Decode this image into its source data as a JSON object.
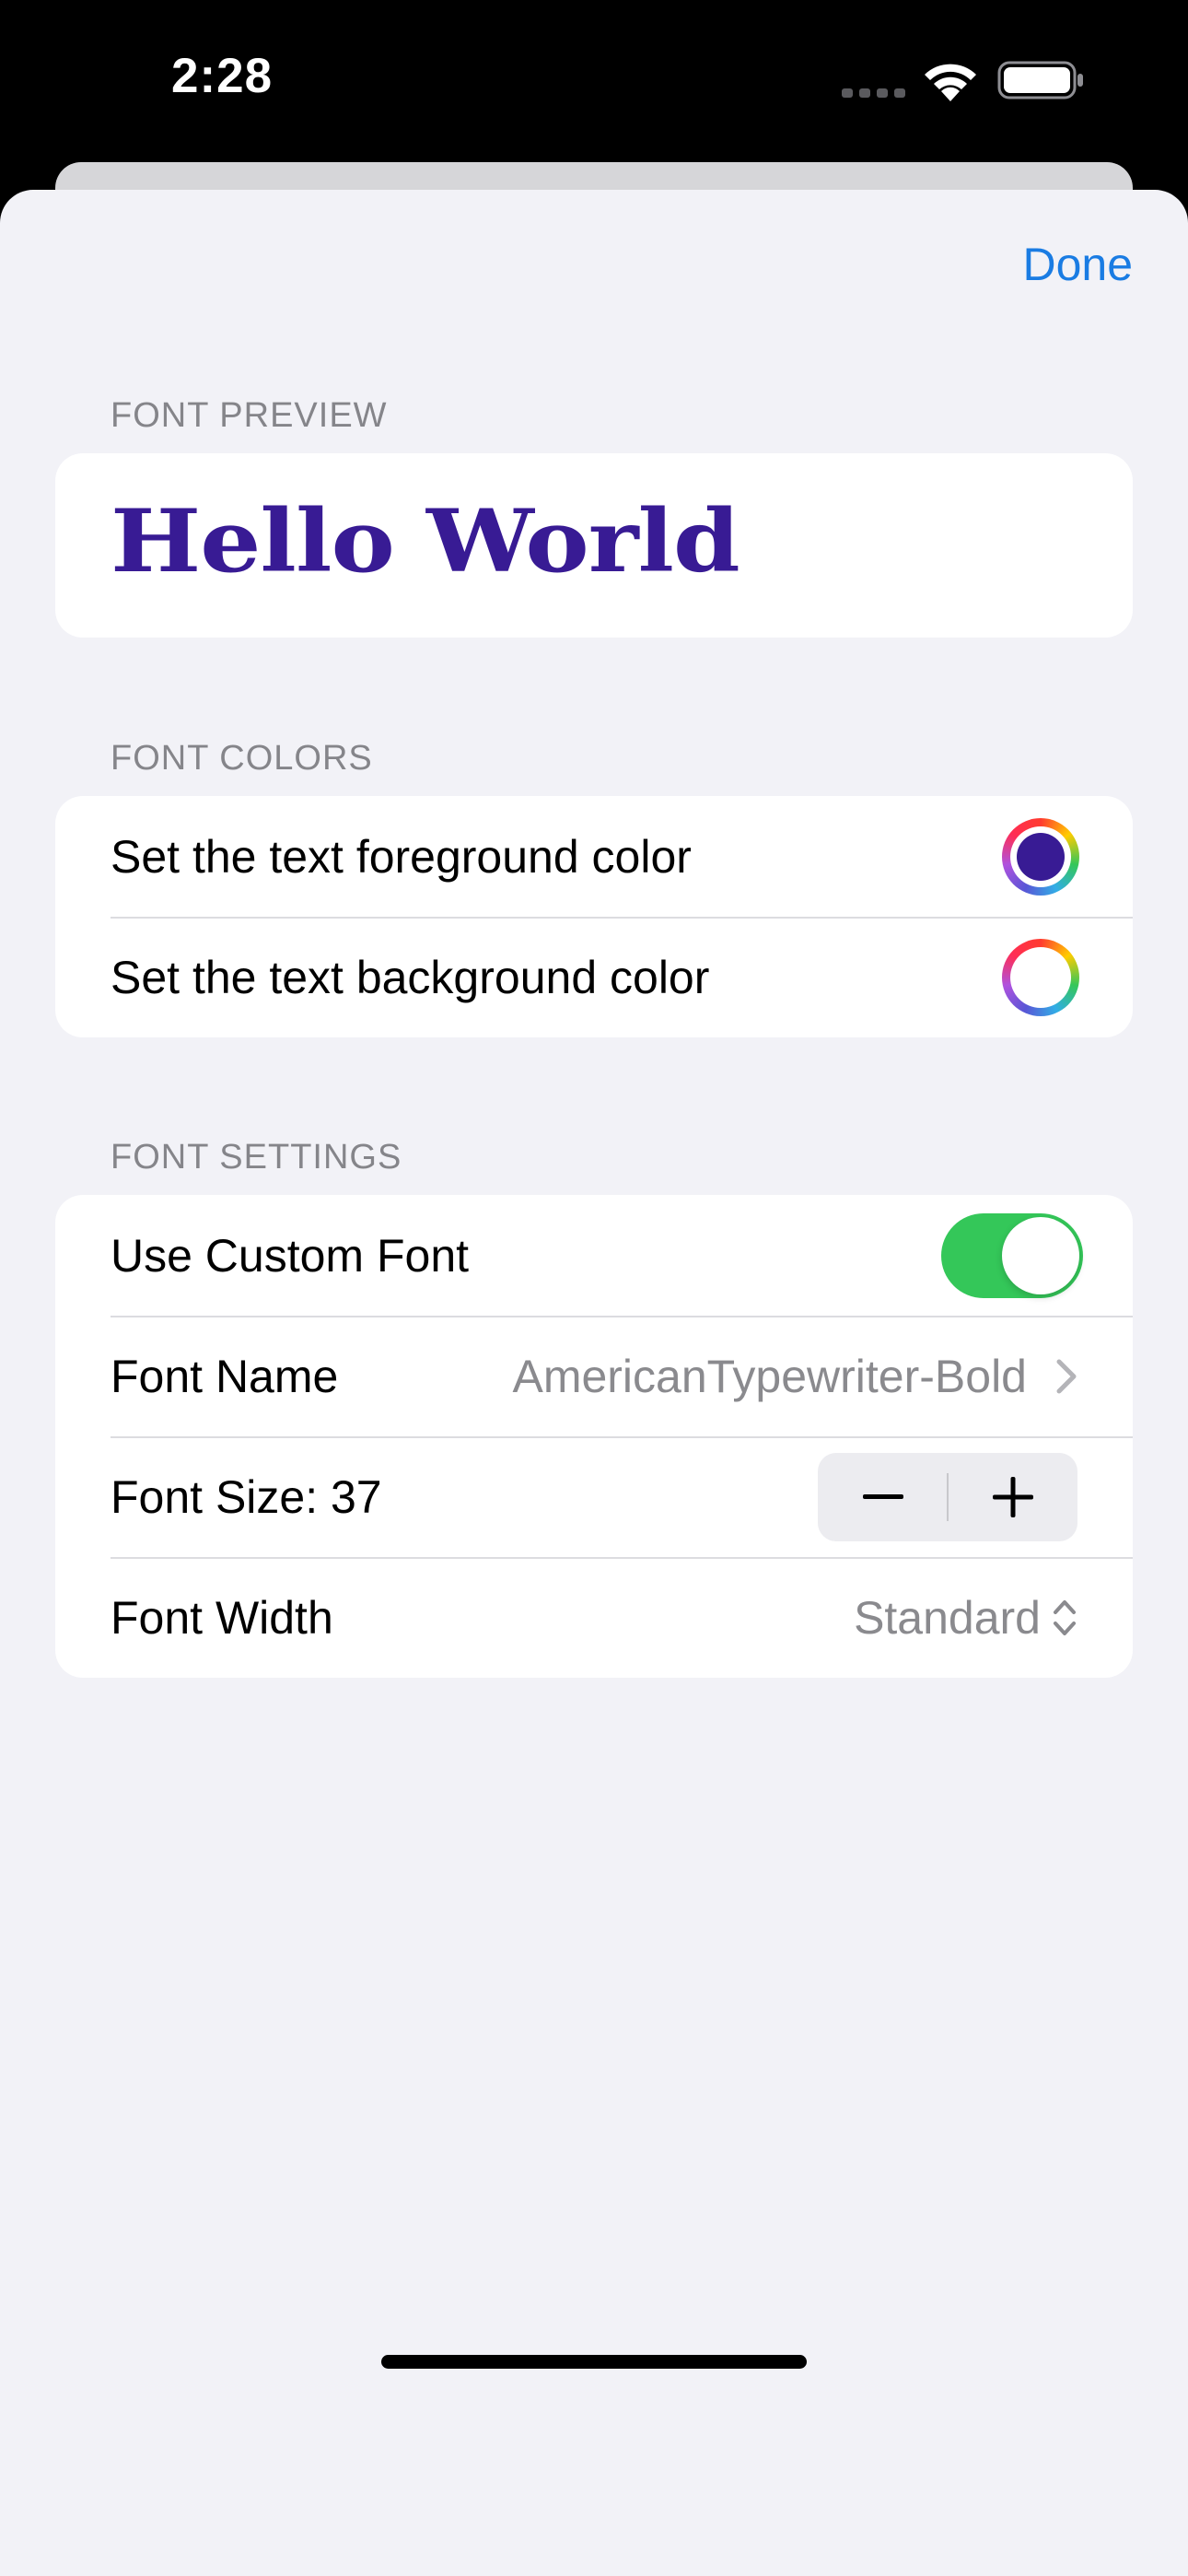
{
  "status_bar": {
    "time": "2:28",
    "signal_icon": "cellular-signal-dots-icon",
    "wifi_icon": "wifi-icon",
    "battery_icon": "battery-full-icon"
  },
  "nav": {
    "done_label": "Done"
  },
  "preview": {
    "header": "FONT PREVIEW",
    "text": "Hello World",
    "text_color": "#381b94"
  },
  "colors": {
    "header": "FONT COLORS",
    "foreground_label": "Set the text foreground color",
    "foreground_color": "#381b94",
    "background_label": "Set the text background color",
    "background_color": "#ffffff"
  },
  "settings": {
    "header": "FONT SETTINGS",
    "custom_font_label": "Use Custom Font",
    "custom_font_on": true,
    "font_name_label": "Font Name",
    "font_name_value": "AmericanTypewriter-Bold",
    "font_size_label": "Font Size: 37",
    "font_width_label": "Font Width",
    "font_width_value": "Standard"
  },
  "accent_color": "#1a7ce3",
  "toggle_on_color": "#34c759"
}
